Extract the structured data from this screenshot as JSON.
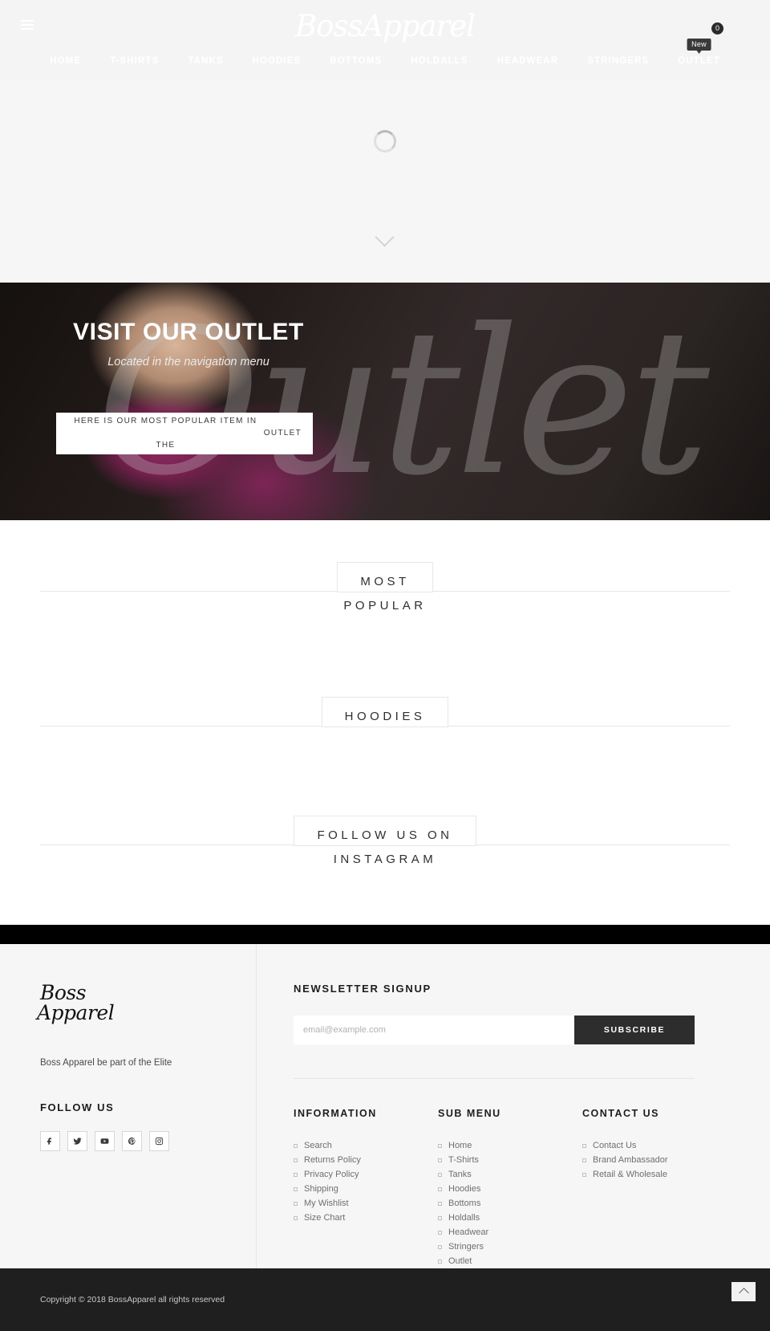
{
  "header": {
    "logo": "BossApparel",
    "menu_icon": "hamburger-icon",
    "cart_count": "0",
    "nav": [
      {
        "label": "HOME"
      },
      {
        "label": "T-SHIRTS"
      },
      {
        "label": "TANKS"
      },
      {
        "label": "HOODIES"
      },
      {
        "label": "BOTTOMS"
      },
      {
        "label": "HOLDALLS"
      },
      {
        "label": "HEADWEAR"
      },
      {
        "label": "STRINGERS"
      },
      {
        "label": "OUTLET",
        "badge": "New"
      }
    ]
  },
  "hero": {
    "loading": "loading-spinner",
    "scroll_hint": "chevron-down-icon"
  },
  "outlet": {
    "script_word": "Outlet",
    "title": "VISIT OUR OUTLET",
    "subtitle": "Located in the navigation menu",
    "card_line1": "HERE IS OUR MOST POPULAR ITEM IN THE",
    "card_line2": "OUTLET"
  },
  "sections": [
    {
      "line1": "MOST",
      "line2": "POPULAR"
    },
    {
      "line1": "HOODIES",
      "line2": ""
    },
    {
      "line1": "FOLLOW US ON",
      "line2": "INSTAGRAM"
    }
  ],
  "footer": {
    "logo_line1": "Boss",
    "logo_line2": "Apparel",
    "tagline": "Boss Apparel be part of the Elite",
    "follow_title": "FOLLOW US",
    "social": [
      {
        "name": "facebook-icon"
      },
      {
        "name": "twitter-icon"
      },
      {
        "name": "youtube-icon"
      },
      {
        "name": "pinterest-icon"
      },
      {
        "name": "instagram-icon"
      }
    ],
    "newsletter": {
      "title": "NEWSLETTER SIGNUP",
      "placeholder": "email@example.com",
      "value": "",
      "button": "SUBSCRIBE"
    },
    "columns": [
      {
        "title": "INFORMATION",
        "items": [
          "Search",
          "Returns Policy",
          "Privacy Policy",
          "Shipping",
          "My Wishlist",
          "Size Chart"
        ]
      },
      {
        "title": "SUB MENU",
        "items": [
          "Home",
          "T-Shirts",
          "Tanks",
          "Hoodies",
          "Bottoms",
          "Holdalls",
          "Headwear",
          "Stringers",
          "Outlet"
        ]
      },
      {
        "title": "CONTACT US",
        "items": [
          "Contact Us",
          "Brand Ambassador",
          "Retail & Wholesale"
        ]
      }
    ],
    "copyright": "Copyright © 2018 BossApparel all rights reserved",
    "back_to_top": "chevron-up-icon"
  },
  "colors": {
    "header_bg": "#f4f4f4",
    "accent_dark": "#2d2d2d",
    "footer_bg": "#f6f6f6",
    "copyright_bg": "#1f1f1f"
  }
}
